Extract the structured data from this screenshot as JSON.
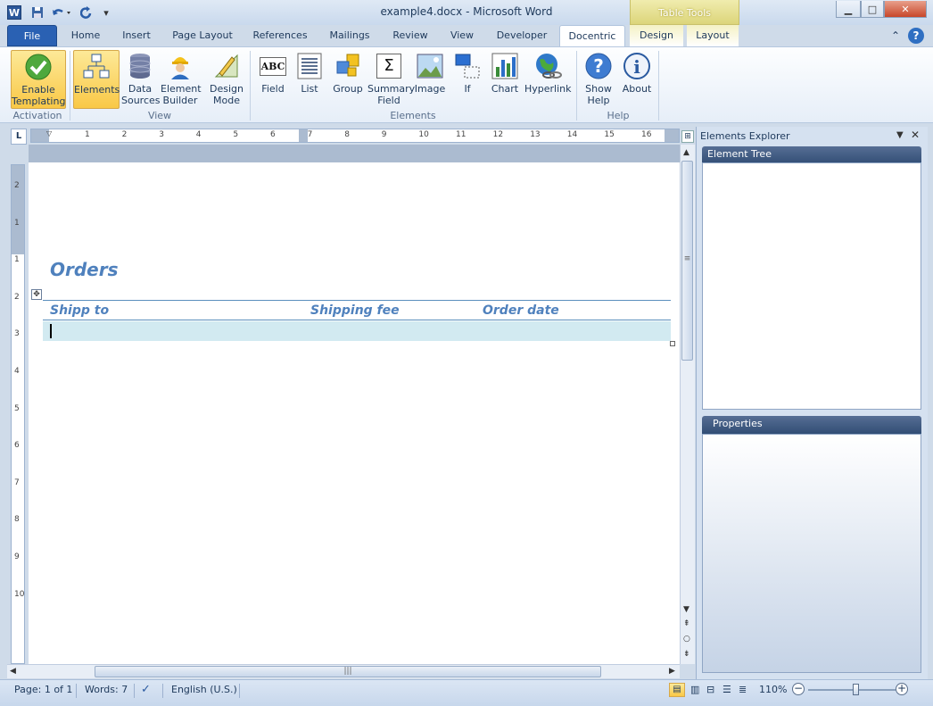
{
  "window": {
    "title": "example4.docx - Microsoft Word",
    "app_icon_letter": "W",
    "context_tab_group": "Table Tools",
    "controls": {
      "minimize": "▁",
      "maximize": "□",
      "close": "✕"
    }
  },
  "tabs": [
    {
      "label": "File"
    },
    {
      "label": "Home"
    },
    {
      "label": "Insert"
    },
    {
      "label": "Page Layout"
    },
    {
      "label": "References"
    },
    {
      "label": "Mailings"
    },
    {
      "label": "Review"
    },
    {
      "label": "View"
    },
    {
      "label": "Developer"
    },
    {
      "label": "Docentric"
    },
    {
      "label": "Design"
    },
    {
      "label": "Layout"
    }
  ],
  "ribbon": {
    "activation": {
      "group": "Activation",
      "enable": "Enable\nTemplating"
    },
    "view": {
      "group": "View",
      "elements": "Elements",
      "data_sources": "Data\nSources",
      "element_builder": "Element\nBuilder",
      "design_mode": "Design\nMode"
    },
    "elements": {
      "group": "Elements",
      "field": "Field",
      "list": "List",
      "group_btn": "Group",
      "summary_field": "Summary\nField",
      "image": "Image",
      "if": "If",
      "chart": "Chart",
      "hyperlink": "Hyperlink"
    },
    "help": {
      "group": "Help",
      "show_help": "Show\nHelp",
      "about": "About"
    }
  },
  "ruler": {
    "h_marks": [
      "1",
      "2",
      "3",
      "4",
      "5",
      "6",
      "7",
      "8",
      "9",
      "10",
      "11",
      "12",
      "13",
      "14",
      "15",
      "16"
    ],
    "v_marks": [
      "2",
      "1",
      "1",
      "2",
      "3",
      "4",
      "5",
      "6",
      "7",
      "8",
      "9",
      "10"
    ]
  },
  "document": {
    "heading": "Orders",
    "table_headers": [
      "Shipp to",
      "Shipping fee",
      "Order date"
    ]
  },
  "pane": {
    "title": "Elements Explorer",
    "tree_header": "Element Tree",
    "props_header": "Properties"
  },
  "status": {
    "page": "Page: 1 of 1",
    "words": "Words: 7",
    "language": "English (U.S.)",
    "zoom": "110%",
    "zoom_level_fraction": 0.55
  },
  "colors": {
    "heading": "#4f81bd",
    "accent_file": "#2a61b3",
    "table_row": "#d2eaf1"
  }
}
